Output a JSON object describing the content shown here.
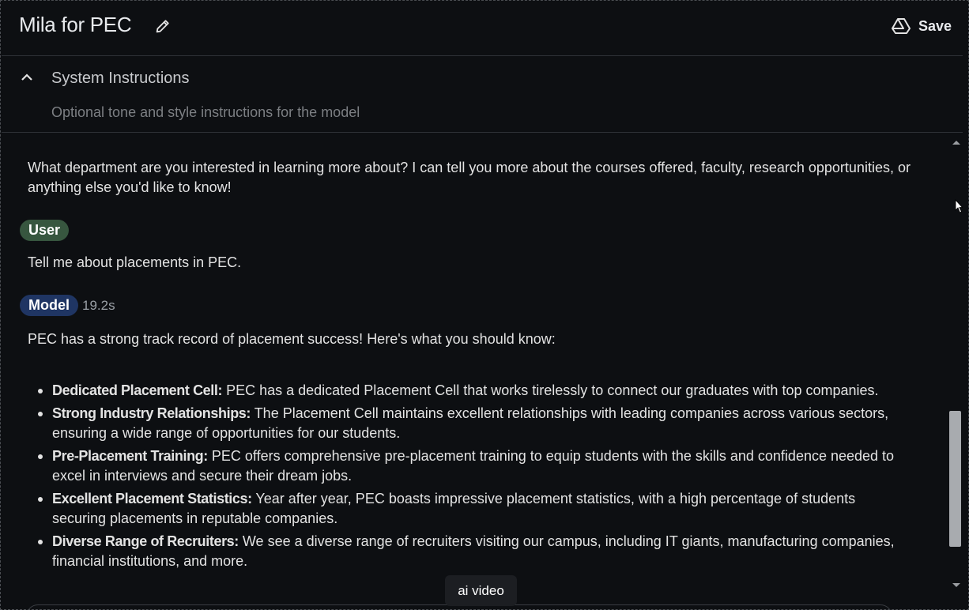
{
  "header": {
    "title": "Mila for PEC",
    "save_label": "Save"
  },
  "system_instructions": {
    "title": "System Instructions",
    "placeholder": "Optional tone and style instructions for the model"
  },
  "chat": {
    "intro_text": "What department are you interested in learning more about? I can tell you more about the courses offered, faculty, research opportunities, or anything else you'd like to know!",
    "user_label": "User",
    "user_message": "Tell me about placements in PEC.",
    "model_label": "Model",
    "model_time": "19.2s",
    "model_intro": "PEC has a strong track record of placement success! Here's what you should know:",
    "bullets": [
      {
        "title": "Dedicated Placement Cell:",
        "text": " PEC has a dedicated Placement Cell that works tirelessly to connect our graduates with top companies."
      },
      {
        "title": "Strong Industry Relationships:",
        "text": " The Placement Cell maintains excellent relationships with leading companies across various sectors, ensuring a wide range of opportunities for our students."
      },
      {
        "title": "Pre-Placement Training:",
        "text": " PEC offers comprehensive pre-placement training to equip students with the skills and confidence needed to excel in interviews and secure their dream jobs."
      },
      {
        "title": "Excellent Placement Statistics:",
        "text": " Year after year, PEC boasts impressive placement statistics, with a high percentage of students securing placements in reputable companies."
      },
      {
        "title": "Diverse Range of Recruiters:",
        "text": " We see a diverse range of recruiters visiting our campus, including IT giants, manufacturing companies, financial institutions, and more."
      }
    ]
  },
  "tooltip": {
    "text": "ai video"
  },
  "icons": {
    "edit": "pencil-icon",
    "save": "drive-icon",
    "collapse": "chevron-up-icon"
  }
}
